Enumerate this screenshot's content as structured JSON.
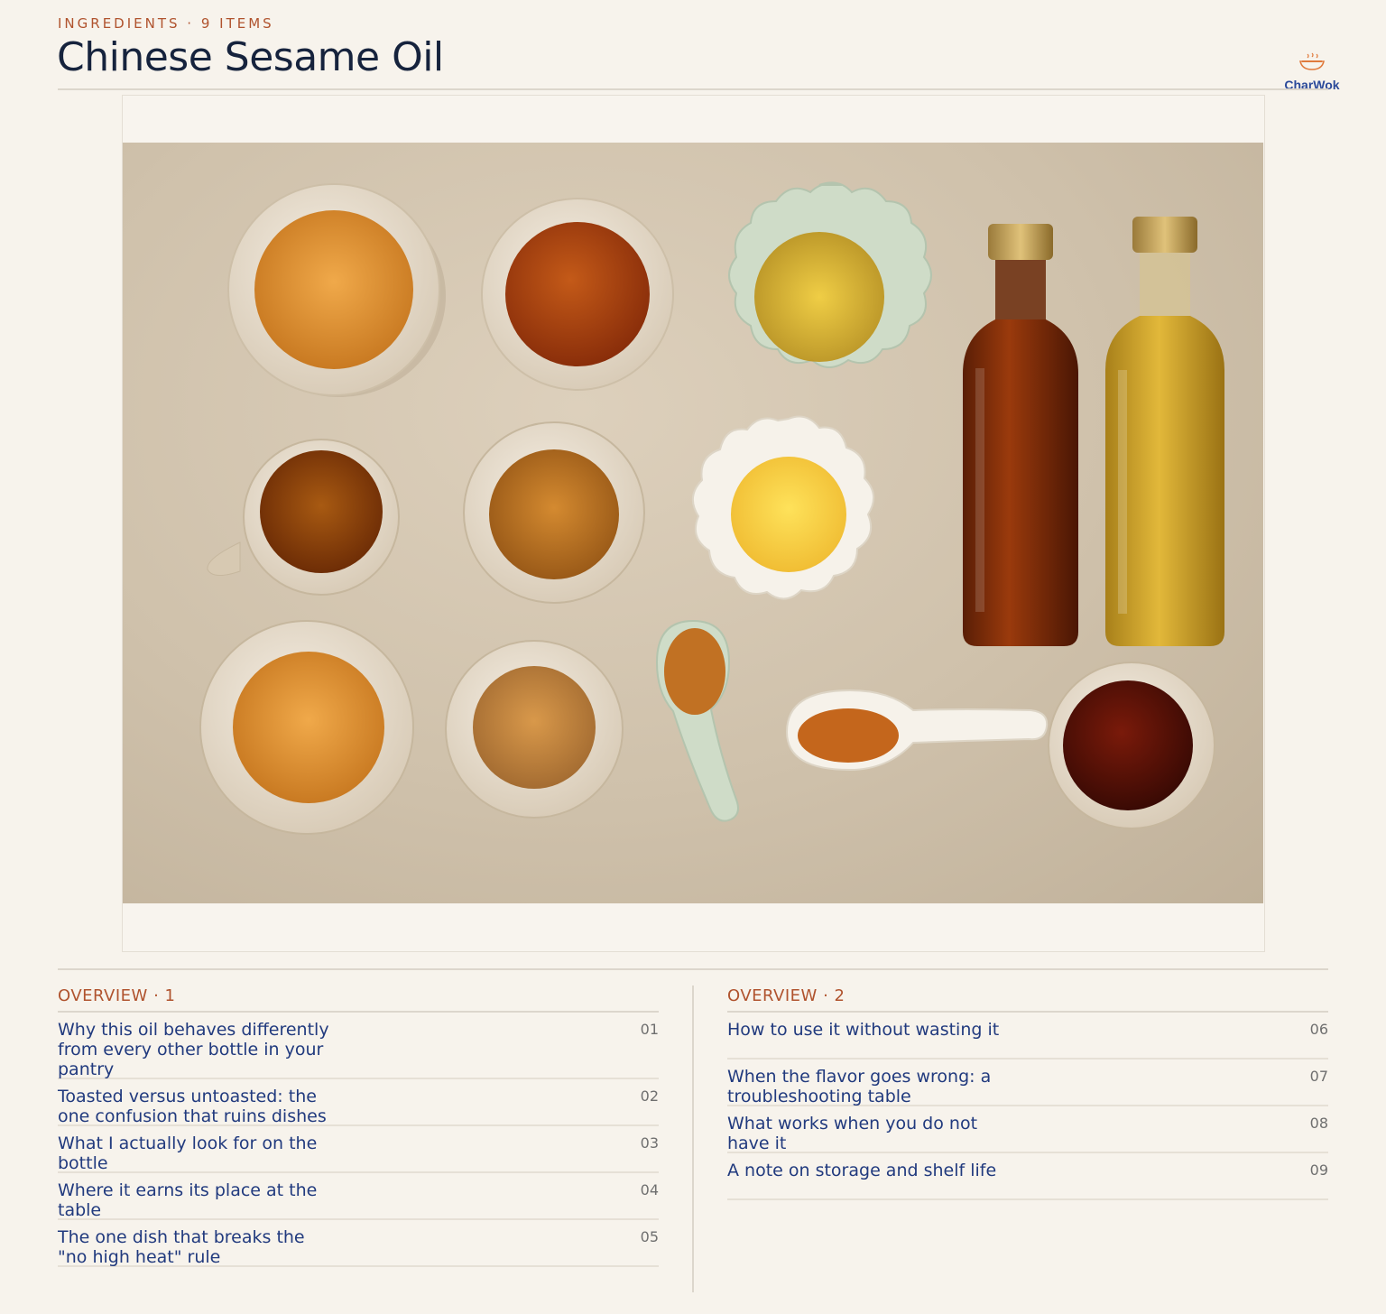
{
  "header": {
    "kicker": "INGREDIENTS · 9 ITEMS",
    "title": "Chinese Sesame Oil"
  },
  "logo": {
    "name": "CharWok",
    "icon": "steaming-bowl-icon"
  },
  "colors": {
    "background": "#f7f3ec",
    "accent": "#b0532e",
    "link": "#213a7e",
    "title": "#16233d"
  },
  "overview_left": {
    "heading": "OVERVIEW · 1",
    "items": [
      {
        "label": "Why this oil behaves differently from every other bottle in your pantry",
        "num": "01"
      },
      {
        "label": "Toasted versus untoasted: the one confusion that ruins dishes",
        "num": "02"
      },
      {
        "label": "What I actually look for on the bottle",
        "num": "03"
      },
      {
        "label": "Where it earns its place at the table",
        "num": "04"
      },
      {
        "label": "The one dish that breaks the \"no high heat\" rule",
        "num": "05"
      }
    ]
  },
  "overview_right": {
    "heading": "OVERVIEW · 2",
    "items": [
      {
        "label": "How to use it without wasting it",
        "num": "06"
      },
      {
        "label": "When the flavor goes wrong: a troubleshooting table",
        "num": "07"
      },
      {
        "label": "What works when you do not have it",
        "num": "08"
      },
      {
        "label": "A note on storage and shelf life",
        "num": "09"
      }
    ]
  }
}
